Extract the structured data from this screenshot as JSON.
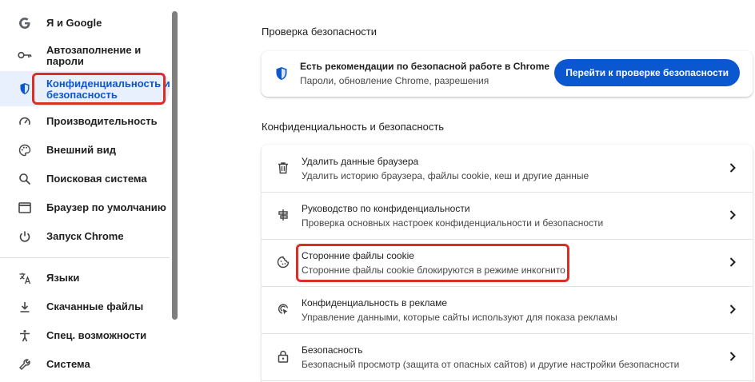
{
  "sidebar": {
    "items": [
      {
        "label": "Я и Google",
        "icon": "google-icon"
      },
      {
        "label": "Автозаполнение и\nпароли",
        "icon": "key-icon"
      },
      {
        "label": "Конфиденциальность и\nбезопасность",
        "icon": "shield-icon",
        "active": true
      },
      {
        "label": "Производительность",
        "icon": "speedometer-icon"
      },
      {
        "label": "Внешний вид",
        "icon": "palette-icon"
      },
      {
        "label": "Поисковая система",
        "icon": "search-icon"
      },
      {
        "label": "Браузер по умолчанию",
        "icon": "browser-window-icon"
      },
      {
        "label": "Запуск Chrome",
        "icon": "power-icon"
      },
      {
        "label": "Языки",
        "icon": "translate-icon"
      },
      {
        "label": "Скачанные файлы",
        "icon": "download-icon"
      },
      {
        "label": "Спец. возможности",
        "icon": "accessibility-icon"
      },
      {
        "label": "Система",
        "icon": "wrench-icon"
      }
    ]
  },
  "safety_check": {
    "section_title": "Проверка безопасности",
    "title": "Есть рекомендации по безопасной работе в Chrome",
    "subtitle": "Пароли, обновление Chrome, разрешения",
    "button_label": "Перейти к проверке безопасности"
  },
  "privacy": {
    "section_title": "Конфиденциальность и безопасность",
    "rows": [
      {
        "title": "Удалить данные браузера",
        "subtitle": "Удалить историю браузера, файлы cookie, кеш и другие данные",
        "icon": "trash-icon"
      },
      {
        "title": "Руководство по конфиденциальности",
        "subtitle": "Проверка основных настроек конфиденциальности и безопасности",
        "icon": "privacy-guide-icon"
      },
      {
        "title": "Сторонние файлы cookie",
        "subtitle": "Сторонние файлы cookie блокируются в режиме инкогнито",
        "icon": "cookie-icon"
      },
      {
        "title": "Конфиденциальность в рекламе",
        "subtitle": "Управление данными, которые сайты используют для показа рекламы",
        "icon": "ad-privacy-icon"
      },
      {
        "title": "Безопасность",
        "subtitle": "Безопасный просмотр (защита от опасных сайтов) и другие настройки безопасности",
        "icon": "lock-icon"
      }
    ]
  },
  "colors": {
    "accent": "#0b57d0",
    "highlight": "#d93025",
    "active_bg": "#e8effd"
  }
}
